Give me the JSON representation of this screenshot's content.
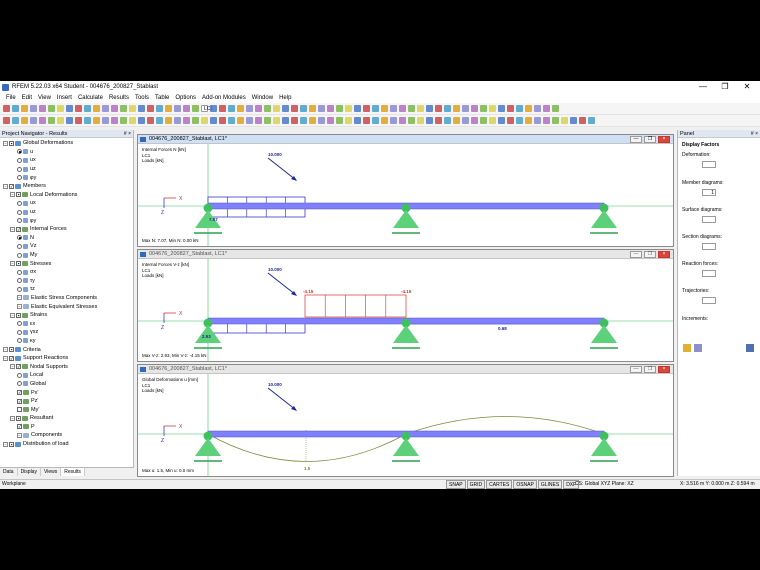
{
  "title": "RFEM 5.22.03 x64 Student - 004676_200827_Stablast",
  "window_controls": {
    "minimize": "—",
    "maximize": "❐",
    "close": "✕"
  },
  "menu": [
    "File",
    "Edit",
    "View",
    "Insert",
    "Calculate",
    "Results",
    "Tools",
    "Table",
    "Options",
    "Add-on Modules",
    "Window",
    "Help"
  ],
  "toolbar": {
    "loadcase": "LC1"
  },
  "navigator": {
    "title": "Project Navigator - Results",
    "pin": "# ×",
    "tabs": [
      "Data",
      "Display",
      "Views",
      "Results"
    ]
  },
  "tree": [
    {
      "label": "Global Deformations",
      "level": 0,
      "mark": "exp",
      "checked": "-"
    },
    {
      "label": "u",
      "level": 2,
      "radio": true,
      "on": true
    },
    {
      "label": "ux",
      "level": 2,
      "radio": true
    },
    {
      "label": "uz",
      "level": 2,
      "radio": true
    },
    {
      "label": "φy",
      "level": 2,
      "radio": true
    },
    {
      "label": "Members",
      "level": 0,
      "mark": "exp",
      "checked": "✓"
    },
    {
      "label": "Local Deformations",
      "level": 1,
      "mark": "exp",
      "checked": "-"
    },
    {
      "label": "ux",
      "level": 2,
      "radio": true
    },
    {
      "label": "uz",
      "level": 2,
      "radio": true
    },
    {
      "label": "φy",
      "level": 2,
      "radio": true
    },
    {
      "label": "Internal Forces",
      "level": 1,
      "mark": "exp",
      "checked": "✓"
    },
    {
      "label": "N",
      "level": 2,
      "radio": true,
      "on": true
    },
    {
      "label": "Vz",
      "level": 2,
      "radio": true
    },
    {
      "label": "My",
      "level": 2,
      "radio": true
    },
    {
      "label": "Stresses",
      "level": 1,
      "mark": "exp",
      "checked": "-"
    },
    {
      "label": "σx",
      "level": 2,
      "radio": true
    },
    {
      "label": "τy",
      "level": 2,
      "radio": true
    },
    {
      "label": "τz",
      "level": 2,
      "radio": true
    },
    {
      "label": "Elastic Stress Components",
      "level": 2,
      "mark": "exp"
    },
    {
      "label": "Elastic Equivalent Stresses",
      "level": 2,
      "mark": "exp"
    },
    {
      "label": "Strains",
      "level": 1,
      "mark": "exp",
      "checked": "-"
    },
    {
      "label": "εx",
      "level": 2,
      "radio": true
    },
    {
      "label": "γxz",
      "level": 2,
      "radio": true
    },
    {
      "label": "κy",
      "level": 2,
      "radio": true
    },
    {
      "label": "Criteria",
      "level": 0,
      "mark": "exp",
      "checked": "-"
    },
    {
      "label": "Support Reactions",
      "level": 0,
      "mark": "exp",
      "checked": "✓"
    },
    {
      "label": "Nodal Supports",
      "level": 1,
      "mark": "exp",
      "checked": "✓"
    },
    {
      "label": "Local",
      "level": 2,
      "radio": true
    },
    {
      "label": "Global",
      "level": 2,
      "radio": true
    },
    {
      "label": "Px'",
      "level": 2,
      "checked": "✓"
    },
    {
      "label": "Pz'",
      "level": 2,
      "checked": "✓"
    },
    {
      "label": "My'",
      "level": 2,
      "checked": ""
    },
    {
      "label": "Resultant",
      "level": 1,
      "mark": "exp",
      "checked": "-"
    },
    {
      "label": "P",
      "level": 2,
      "checked": "✓"
    },
    {
      "label": "Components",
      "level": 2,
      "mark": "exp"
    },
    {
      "label": "Distribution of load",
      "level": 0,
      "mark": "exp",
      "checked": "-"
    }
  ],
  "views": [
    {
      "title": "004676_200827_Stablast, LC1*",
      "active": true,
      "info": [
        "Internal Forces N [kN]",
        "LC1",
        "Loads [kN]"
      ],
      "footer": "Max N: 7.07, Min N: 0.00 kN",
      "load": "10.000",
      "values": [
        "7.07"
      ]
    },
    {
      "title": "004676_200827_Stablast, LC1*",
      "active": false,
      "info": [
        "Internal Forces V-z [kN]",
        "LC1",
        "Loads [kN]"
      ],
      "footer": "Max V-z: 2.93, Min V-z: -4.15 kN",
      "load": "10.000",
      "values": [
        "-4.15",
        "-4.15",
        "2.93",
        "0.68"
      ]
    },
    {
      "title": "004676_200827_Stablast, LC1*",
      "active": false,
      "info": [
        "Global Deformations u [mm]",
        "LC1",
        "Loads [kN]"
      ],
      "footer": "Max u: 1.5, Min u: 0.0 mm",
      "load": "10.000",
      "values": [
        "1.5"
      ]
    }
  ],
  "axes": {
    "x": "X",
    "z": "Z"
  },
  "panel": {
    "title": "Panel",
    "pin": "# ×",
    "heading": "Display Factors",
    "fields": [
      "Deformation:",
      "Member diagrams:",
      "Surface diagrams:",
      "Section diagrams:",
      "Reaction forces:",
      "Trajectories:"
    ],
    "member_value": "1",
    "increments": "Increments:"
  },
  "status": {
    "left": "Workplane",
    "buttons": [
      "SNAP",
      "GRID",
      "CARTES",
      "OSNAP",
      "GLINES",
      "DXF"
    ],
    "cs": "CS: Global XYZ   Plane: XZ",
    "coords": "X: 3.516 m   Y: 0.000 m   Z: 0.594 m"
  },
  "colors": {
    "beam": "#8080ff",
    "support": "#3fc060",
    "diagram_red": "#d83030",
    "diagram_blue": "#2020c0",
    "deflection": "#7a8a3a"
  }
}
